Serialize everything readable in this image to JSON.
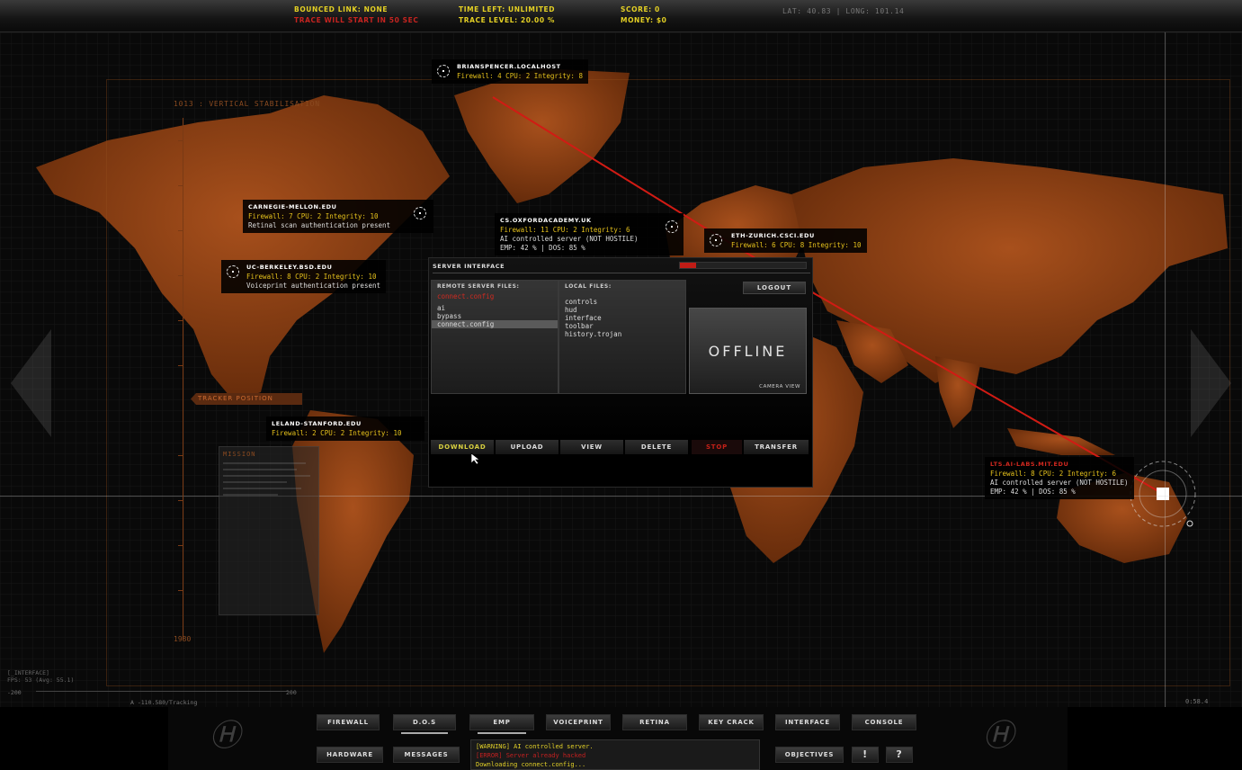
{
  "top": {
    "bounced_link": "Bounced link: NONE",
    "trace_warning": "Trace will start in 50 sec",
    "time_left": "Time left: UNLIMITED",
    "trace_level": "Trace level: 20.00 %",
    "score": "Score: 0",
    "money": "Money: $0",
    "coords": "LAT: 40.83 | LONG: 101.14"
  },
  "map": {
    "ruler_top_label": "1013 : VERTICAL STABILISATION",
    "ruler_bottom_label": "1980",
    "tracker_label": "TRACKER POSITION",
    "mission_title": "MISSION"
  },
  "hosts": [
    {
      "name": "brianspencer.localhost",
      "stats": "Firewall: 4 CPU: 2 Integrity: 8",
      "extra": ""
    },
    {
      "name": "carnegie-mellon.edu",
      "stats": "Firewall: 7 CPU: 2 Integrity: 10",
      "extra": "Retinal scan authentication present"
    },
    {
      "name": "cs.oxfordacademy.uk",
      "stats": "Firewall: 11 CPU: 2 Integrity: 6",
      "extra": "AI controlled server (NOT HOSTILE)",
      "extra2": "EMP:  42 % | DOS:  85 %"
    },
    {
      "name": "eth-zurich.csci.edu",
      "stats": "Firewall: 6 CPU: 8 Integrity: 10",
      "extra": ""
    },
    {
      "name": "uc-berkeley.bsd.edu",
      "stats": "Firewall: 8 CPU: 2 Integrity: 10",
      "extra": "Voiceprint authentication present"
    },
    {
      "name": "leland-stanford.edu",
      "stats": "Firewall: 2 CPU: 2 Integrity: 10",
      "extra": ""
    },
    {
      "name": "lts.ai-labs.mit.edu",
      "stats": "Firewall: 8 CPU: 2 Integrity: 6",
      "extra": "AI controlled server (NOT HOSTILE)",
      "extra2": "EMP:  42 % | DOS:  85 %"
    }
  ],
  "server_interface": {
    "title": "SERVER INTERFACE",
    "trace_progress": 0.13,
    "remote_header": "REMOTE SERVER FILES:",
    "remote_selected_file": "connect.config",
    "remote_files": [
      "ai",
      "bypass",
      "connect.config"
    ],
    "remote_highlight_index": 2,
    "local_header": "LOCAL FILES:",
    "local_files": [
      "controls",
      "hud",
      "interface",
      "toolbar",
      "history.trojan"
    ],
    "logout": "LOGOUT",
    "camera_status": "OFFLINE",
    "camera_label": "CAMERA VIEW",
    "buttons": {
      "download": "DOWNLOAD",
      "upload": "UPLOAD",
      "view": "VIEW",
      "delete": "DELETE",
      "stop": "STOP",
      "transfer": "TRANSFER"
    }
  },
  "debug": {
    "line1": "[_INTERFACE]",
    "line2": "FPS:  53 (Avg: 55.1)",
    "ruler_left": "-200",
    "ruler_right": "200",
    "ruler_mid": "A -110.580/Tracking",
    "time": "0:58.4"
  },
  "toolbar": {
    "firewall": "FIREWALL",
    "dos": "D.O.S",
    "emp": "EMP",
    "voiceprint": "VOICEPRINT",
    "retina": "RETINA",
    "keycrack": "KEY CRACK",
    "interface": "INTERFACE",
    "console": "CONSOLE",
    "hardware": "HARDWARE",
    "messages": "MESSAGES",
    "objectives": "OBJECTIVES",
    "alert_glyph": "!",
    "help_glyph": "?",
    "logo_glyph": "Ⓗ",
    "messages_log": [
      "[WARNING] AI controlled server.",
      "[ERROR] Server already hacked",
      "Downloading connect.config..."
    ]
  }
}
